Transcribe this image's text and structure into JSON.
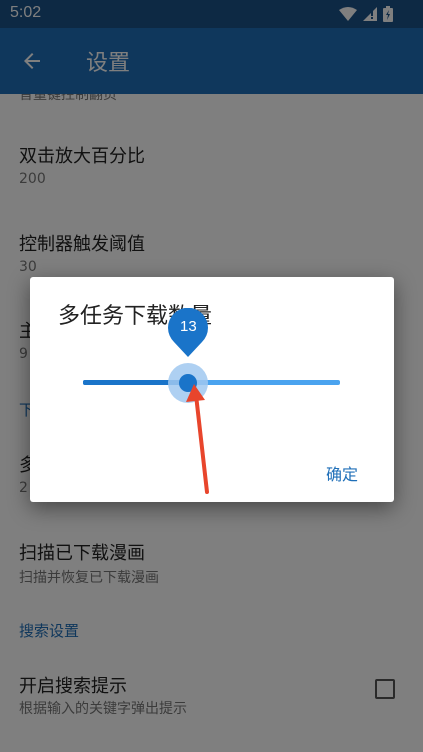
{
  "status_bar": {
    "time": "5:02"
  },
  "app_bar": {
    "title": "设置",
    "back_icon": "arrow-left-icon"
  },
  "preferences": [
    {
      "title": "音量键控制翻页",
      "summary": ""
    },
    {
      "title": "双击放大百分比",
      "summary": "200"
    },
    {
      "title": "控制器触发阈值",
      "summary": "30"
    },
    {
      "title": "主",
      "summary": "9"
    },
    {
      "category": "下"
    },
    {
      "title": "多",
      "summary": "2"
    },
    {
      "title": "扫描已下载漫画",
      "summary": "扫描并恢复已下载漫画"
    },
    {
      "category": "搜索设置"
    },
    {
      "title": "开启搜索提示",
      "summary": "根据输入的关键字弹出提示",
      "checked": false
    }
  ],
  "dialog": {
    "title": "多任务下载数量",
    "slider": {
      "value": "13",
      "fraction": 0.41
    },
    "confirm_label": "确定"
  },
  "colors": {
    "status_bar": "#1a5388",
    "app_bar": "#1f6fb8",
    "accent": "#1a74c9",
    "annotation_arrow": "#e8452c"
  }
}
